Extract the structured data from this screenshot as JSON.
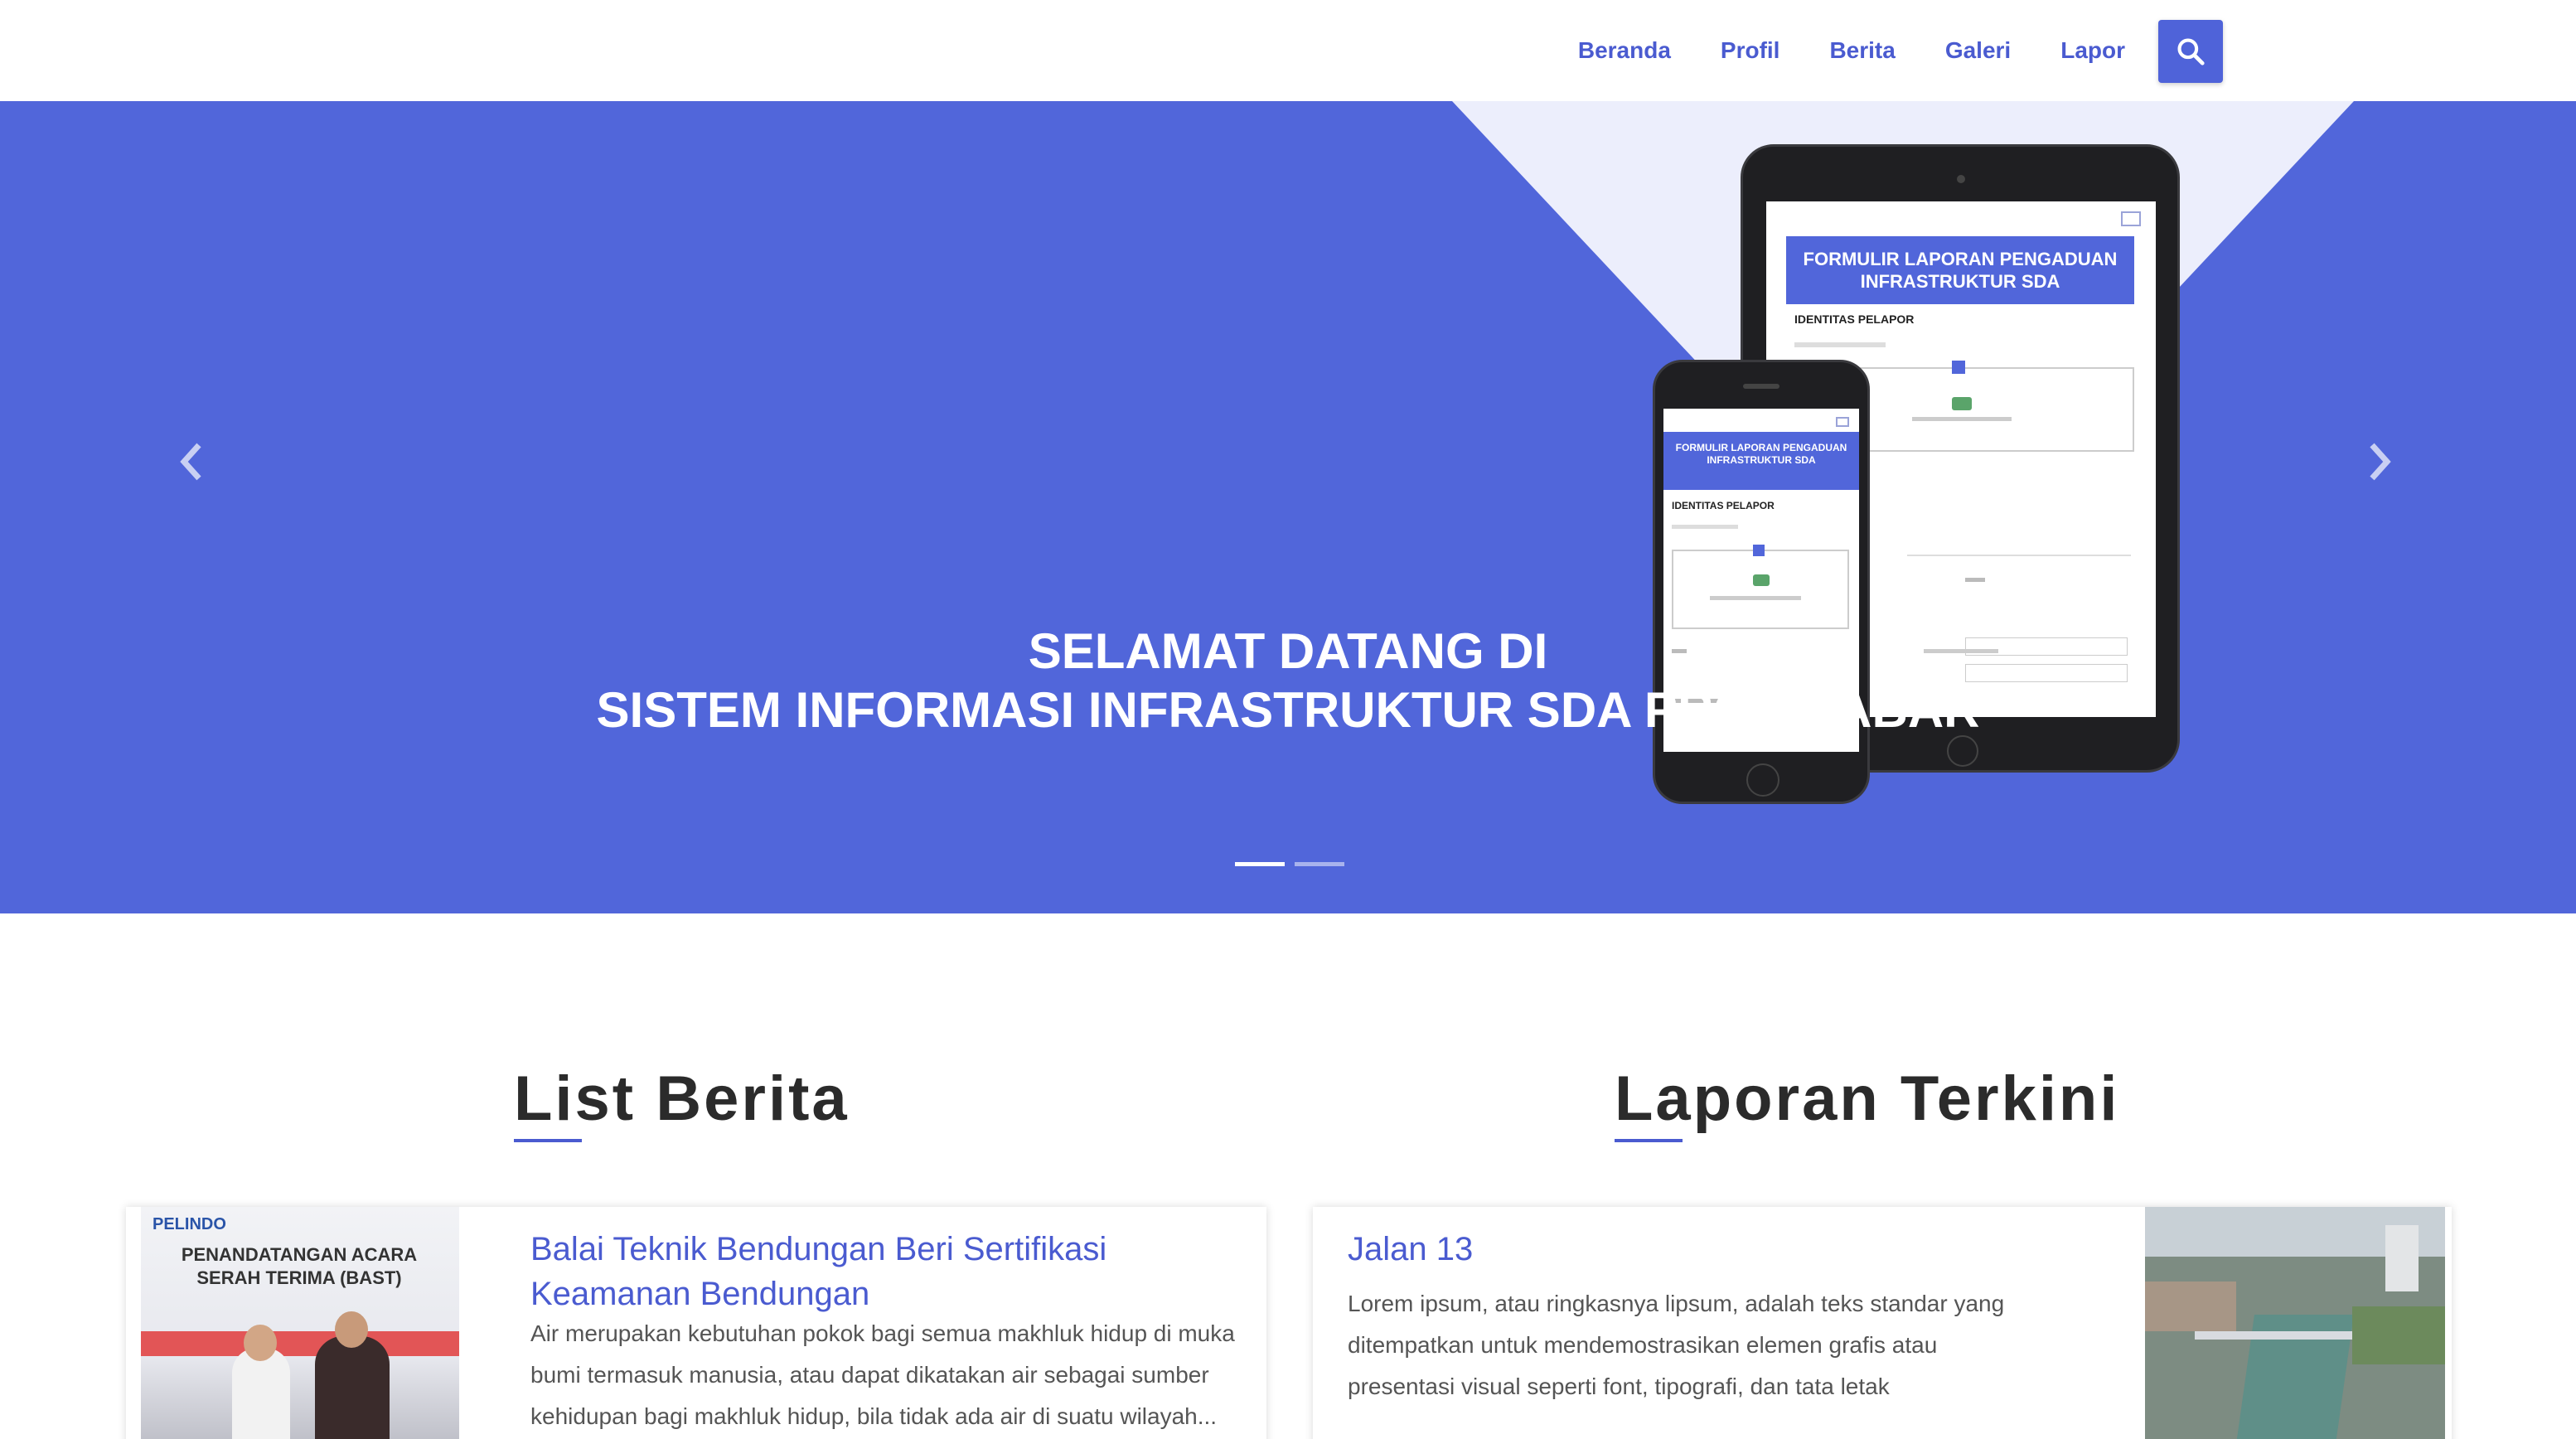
{
  "nav": {
    "items": [
      "Beranda",
      "Profil",
      "Berita",
      "Galeri",
      "Lapor"
    ],
    "search_icon": "search-icon"
  },
  "hero": {
    "line1": "SELAMAT DATANG DI",
    "line2": "SISTEM INFORMASI INFRASTRUKTUR SDA PROV. JABAR",
    "prev_icon": "chevron-left-icon",
    "next_icon": "chevron-right-icon",
    "slides": 2,
    "active_slide": 1,
    "mockup": {
      "form_title": "FORMULIR LAPORAN PENGADUAN INFRASTRUKTUR SDA",
      "section": "IDENTITAS PELAPOR"
    }
  },
  "news": {
    "heading": "List Berita",
    "item": {
      "title": "Balai Teknik Bendungan Beri Sertifikasi Keamanan Bendungan",
      "excerpt": "Air merupakan kebutuhan pokok bagi semua makhluk hidup di muka bumi termasuk manusia, atau dapat dikatakan air sebagai sumber kehidupan bagi makhluk hidup, bila tidak ada air di suatu wilayah...",
      "image_caption": "PENANDATANGAN ACARA SERAH TERIMA (BAST)"
    }
  },
  "reports": {
    "heading": "Laporan Terkini",
    "item": {
      "title": "Jalan 13",
      "text": "Lorem ipsum, atau ringkasnya lipsum, adalah teks standar yang ditempatkan untuk mendemostrasikan elemen grafis atau presentasi visual seperti font, tipografi, dan tata letak"
    }
  },
  "colors": {
    "accent": "#4a5bd0",
    "hero_bg": "#5166da"
  }
}
